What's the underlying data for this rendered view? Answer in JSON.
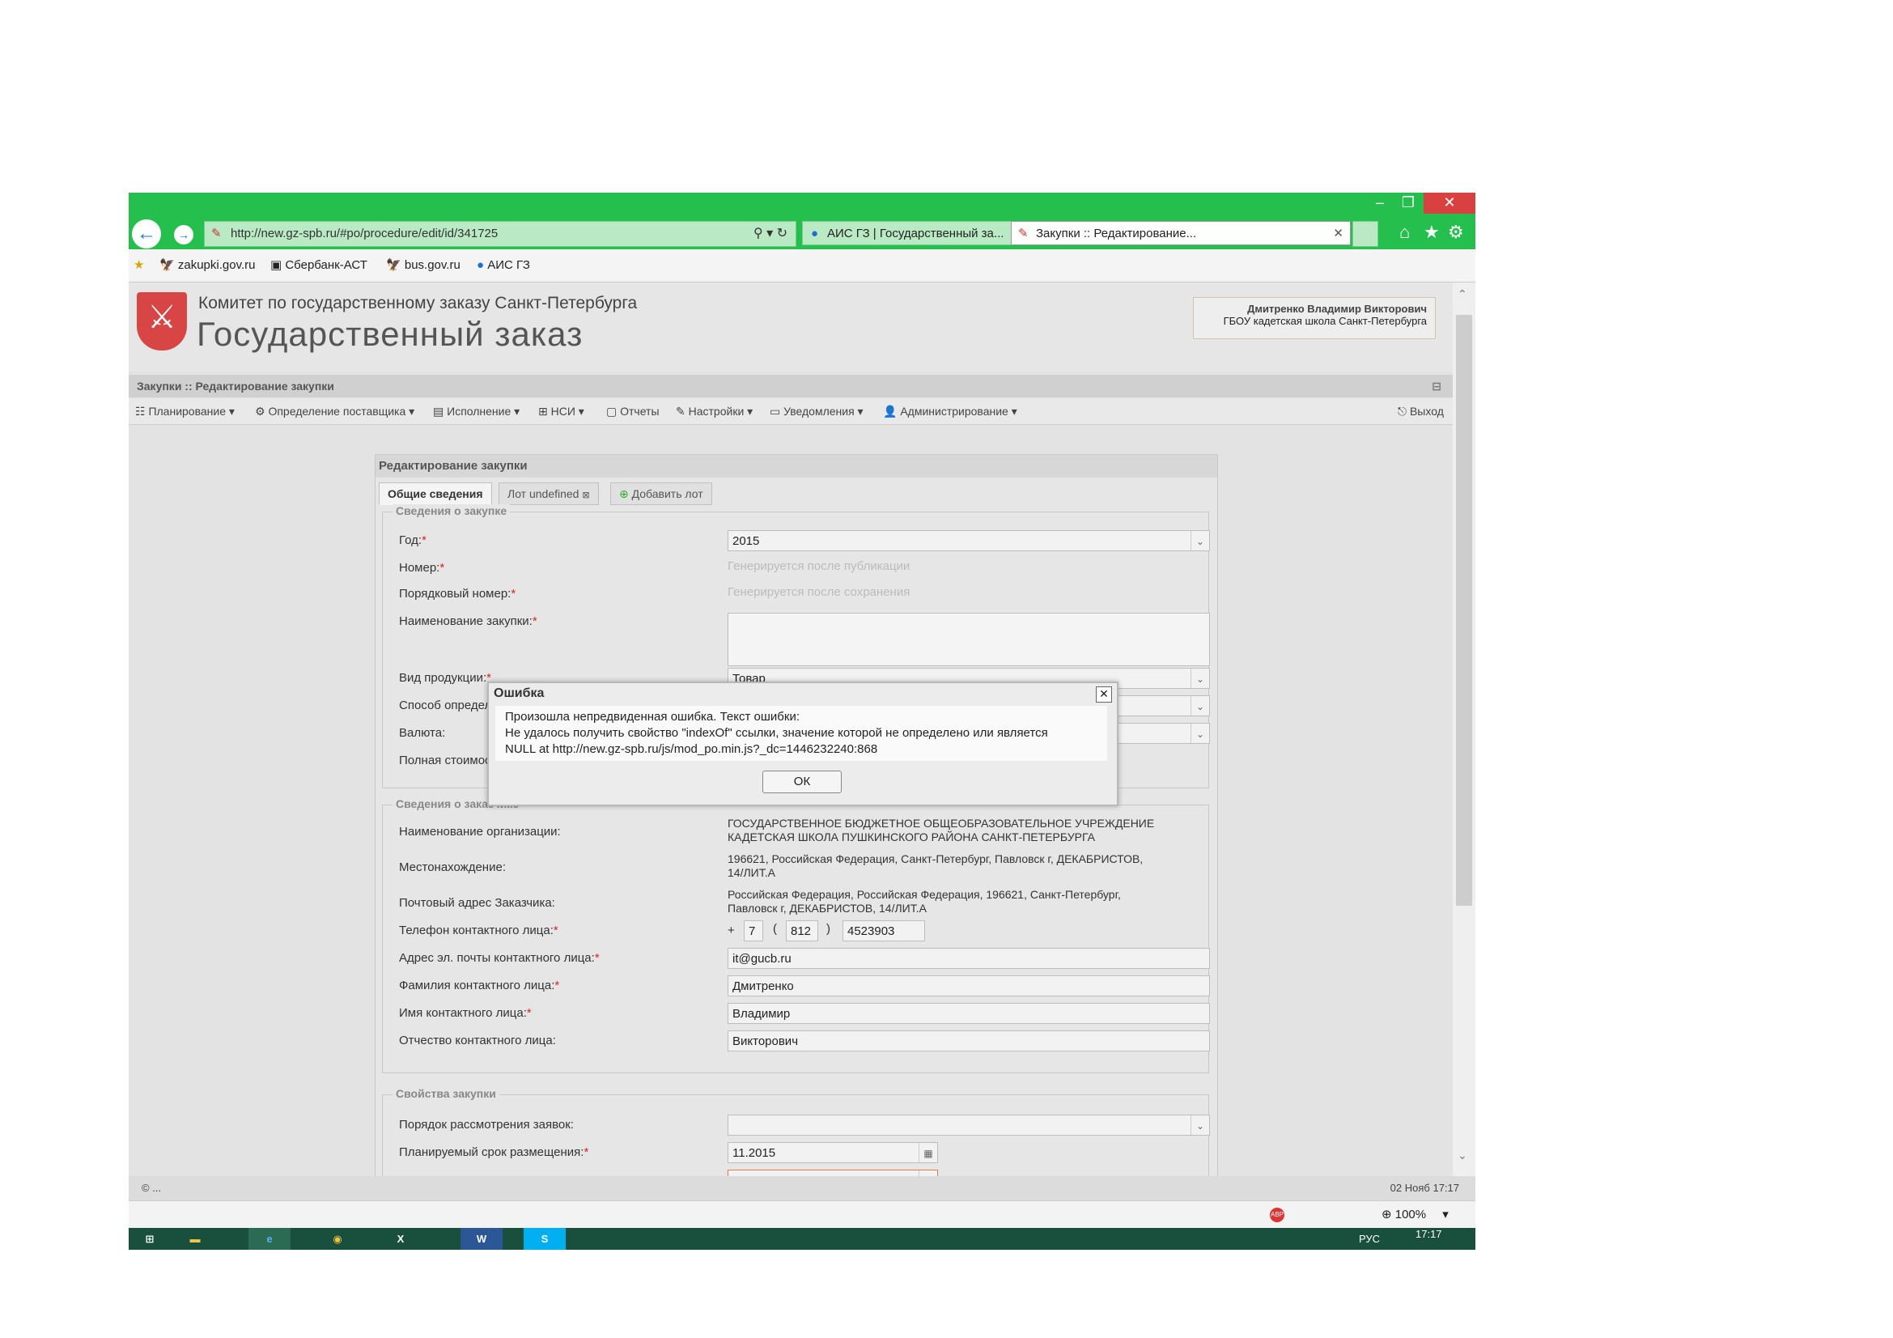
{
  "browser": {
    "url": "http://new.gz-spb.ru/#po/procedure/edit/id/341725",
    "tabs": [
      {
        "label": "АИС ГЗ | Государственный за..."
      },
      {
        "label": "Закупки :: Редактирование..."
      }
    ],
    "favorites": [
      "zakupki.gov.ru",
      "Сбербанк-АСТ",
      "bus.gov.ru",
      "АИС ГЗ"
    ],
    "zoom": "100%"
  },
  "header": {
    "org_line1": "Комитет по государственному заказу Санкт-Петербурга",
    "org_line2": "Государственный заказ",
    "user_name": "Дмитренко Владимир Викторович",
    "user_org": "ГБОУ кадетская школа Санкт-Петербурга"
  },
  "breadcrumb": "Закупки :: Редактирование закупки",
  "menu": {
    "items": [
      "Планирование",
      "Определение поставщика",
      "Исполнение",
      "НСИ",
      "Отчеты",
      "Настройки",
      "Уведомления",
      "Администрирование"
    ],
    "logout": "Выход"
  },
  "panel": {
    "title": "Редактирование закупки",
    "tabs": [
      "Общие сведения",
      "Лот undefined",
      "Добавить лот"
    ]
  },
  "section_purchase": {
    "legend": "Сведения о закупке",
    "year_label": "Год:",
    "year_value": "2015",
    "number_label": "Номер:",
    "number_value": "Генерируется после публикации",
    "seq_label": "Порядковый номер:",
    "seq_value": "Генерируется после сохранения",
    "name_label": "Наименование закупки:",
    "kind_label": "Вид продукции:",
    "kind_value": "Товар",
    "method_label": "Способ определ",
    "currency_label": "Валюта:",
    "cost_label": "Полная стоимос"
  },
  "section_customer": {
    "legend": "Сведения о заказчике",
    "org_label": "Наименование организации:",
    "org_value_1": "ГОСУДАРСТВЕННОЕ БЮДЖЕТНОЕ ОБЩЕОБРАЗОВАТЕЛЬНОЕ УЧРЕЖДЕНИЕ",
    "org_value_2": "КАДЕТСКАЯ ШКОЛА ПУШКИНСКОГО РАЙОНА САНКТ-ПЕТЕРБУРГА",
    "loc_label": "Местонахождение:",
    "loc_value_1": "196621, Российская Федерация, Санкт-Петербург, Павловск г, ДЕКАБРИСТОВ,",
    "loc_value_2": "14/ЛИТ.А",
    "post_label": "Почтовый адрес Заказчика:",
    "post_value_1": "Российская Федерация, Российская Федерация, 196621, Санкт-Петербург,",
    "post_value_2": "Павловск г, ДЕКАБРИСТОВ, 14/ЛИТ.А",
    "phone_label": "Телефон контактного лица:",
    "phone_plus": "+",
    "phone_country": "7",
    "phone_open": "(",
    "phone_code": "812",
    "phone_close": ")",
    "phone_number": "4523903",
    "email_label": "Адрес эл. почты контактного лица:",
    "email_value": "it@gucb.ru",
    "lastname_label": "Фамилия контактного лица:",
    "lastname_value": "Дмитренко",
    "firstname_label": "Имя контактного лица:",
    "firstname_value": "Владимир",
    "middlename_label": "Отчество контактного лица:",
    "middlename_value": "Викторович"
  },
  "section_props": {
    "legend": "Свойства закупки",
    "order_label": "Порядок рассмотрения заявок:",
    "term_label": "Планируемый срок размещения:",
    "term_value": "11.2015"
  },
  "dialog": {
    "title": "Ошибка",
    "line1": "Произошла непредвиденная ошибка. Текст ошибки:",
    "line2": "Не удалось получить свойство \"indexOf\" ссылки, значение которой не определено или является",
    "line3": "NULL at http://new.gz-spb.ru/js/mod_po.min.js?_dc=1446232240:868",
    "ok": "ОК"
  },
  "statusbar": {
    "left": "© ...",
    "right": "02 Нояб 17:17"
  },
  "taskbar": {
    "clock": "17:17",
    "lang": "РУС"
  }
}
